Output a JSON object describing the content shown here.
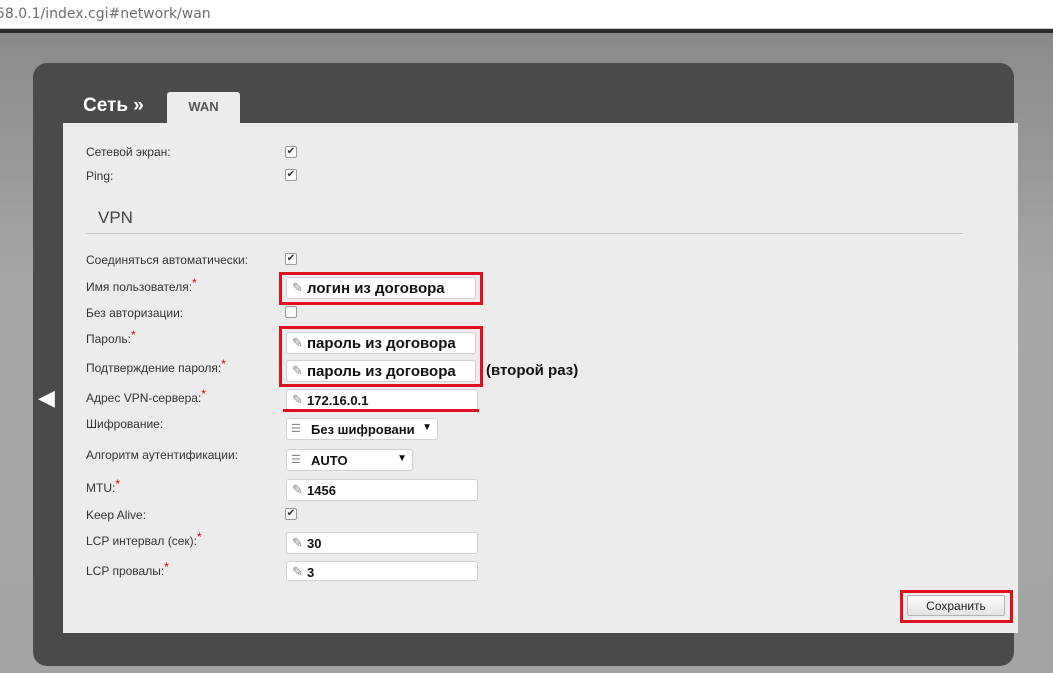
{
  "url": "58.0.1/index.cgi#network/wan",
  "header": {
    "breadcrumb": "Сеть »",
    "tab": "WAN"
  },
  "fields": {
    "firewall_label": "Сетевой экран:",
    "ping_label": "Ping:",
    "vpn_title": "VPN",
    "auto_connect_label": "Соединяться автоматически:",
    "username_label": "Имя пользователя:",
    "username_value": "логин из договора",
    "no_auth_label": "Без авторизации:",
    "password_label": "Пароль:",
    "password_value": "пароль из договора",
    "password_confirm_label": "Подтверждение пароля:",
    "password_confirm_value": "пароль из договора",
    "second_time_note": "(второй раз)",
    "vpn_server_label": "Адрес VPN-сервера:",
    "vpn_server_value": "172.16.0.1",
    "encryption_label": "Шифрование:",
    "encryption_value": "Без шифровани",
    "auth_algo_label": "Алгоритм аутентификации:",
    "auth_algo_value": "AUTO",
    "mtu_label": "MTU:",
    "mtu_value": "1456",
    "keepalive_label": "Keep Alive:",
    "lcp_interval_label": "LCP интервал (сек):",
    "lcp_interval_value": "30",
    "lcp_failures_label": "LCP провалы:",
    "lcp_failures_value": "3",
    "required_mark": "*"
  },
  "checkboxes": {
    "firewall": true,
    "ping": true,
    "auto_connect": true,
    "no_auth": false,
    "keepalive": true
  },
  "buttons": {
    "save": "Сохранить"
  },
  "colors": {
    "highlight": "#e0101e",
    "panel": "#4a4a4a",
    "content": "#ececec"
  }
}
